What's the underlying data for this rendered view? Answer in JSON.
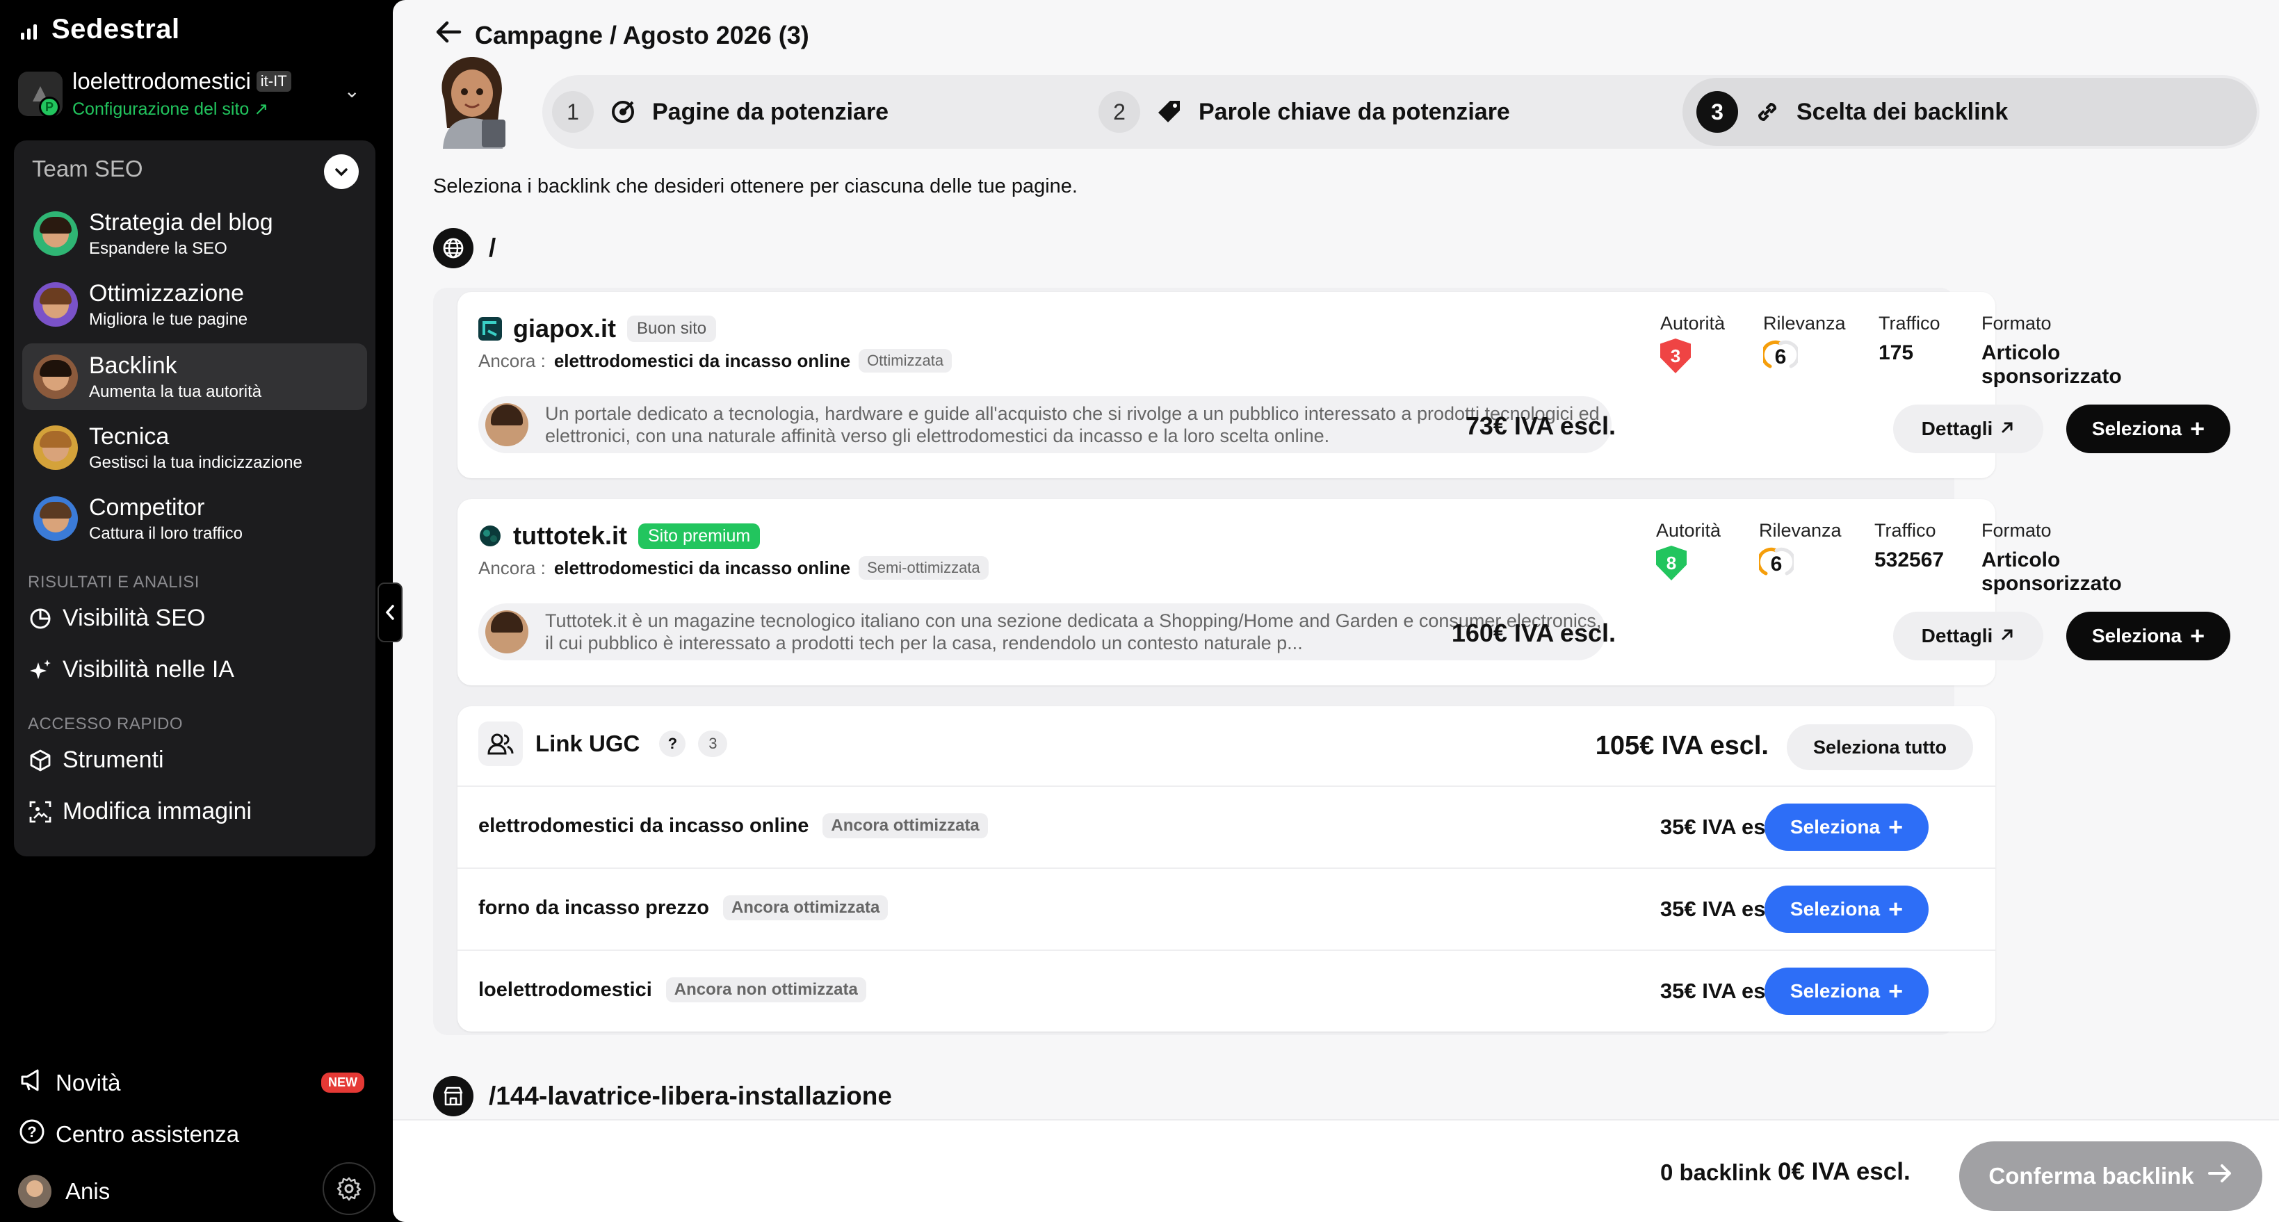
{
  "brand": {
    "name": "Sedestral"
  },
  "site": {
    "name": "loelettrodomestici",
    "locale": "it-IT",
    "config_link": "Configurazione del sito ↗",
    "logo_badge": "P"
  },
  "team": {
    "title": "Team SEO",
    "agents": [
      {
        "title": "Strategia del blog",
        "subtitle": "Espandere la SEO"
      },
      {
        "title": "Ottimizzazione",
        "subtitle": "Migliora le tue pagine"
      },
      {
        "title": "Backlink",
        "subtitle": "Aumenta la tua autorità"
      },
      {
        "title": "Tecnica",
        "subtitle": "Gestisci la tua indicizzazione"
      },
      {
        "title": "Competitor",
        "subtitle": "Cattura il loro traffico"
      }
    ],
    "section_results": "RISULTATI E ANALISI",
    "results_links": [
      "Visibilità SEO",
      "Visibilità nelle IA"
    ],
    "section_quick": "ACCESSO RAPIDO",
    "quick_links": [
      "Strumenti",
      "Modifica immagini"
    ]
  },
  "bottom": {
    "news": "Novità",
    "news_badge": "NEW",
    "help": "Centro assistenza",
    "user": "Anis"
  },
  "header": {
    "breadcrumb": "Campagne / Agosto 2026 (3)"
  },
  "steps": [
    {
      "num": "1",
      "label": "Pagine da potenziare"
    },
    {
      "num": "2",
      "label": "Parole chiave da potenziare"
    },
    {
      "num": "3",
      "label": "Scelta dei backlink"
    }
  ],
  "intro": "Seleziona i backlink che desideri ottenere per ciascuna delle tue pagine.",
  "pages": [
    {
      "path": "/"
    },
    {
      "path": "/144-lavatrice-libera-installazione"
    }
  ],
  "metric_labels": {
    "authority": "Autorità",
    "relevance": "Rilevanza",
    "traffic": "Traffico",
    "format": "Formato"
  },
  "anchor_label": "Ancora :",
  "offers": [
    {
      "domain": "giapox.it",
      "tag": "Buon sito",
      "anchor": "elettrodomestici da incasso online",
      "anchor_tag": "Ottimizzata",
      "authority": "3",
      "relevance": "6",
      "traffic": "175",
      "format": "Articolo sponsorizzato",
      "description": "Un portale dedicato a tecnologia, hardware e guide all'acquisto che si rivolge a un pubblico interessato a prodotti tecnologici ed elettronici, con una naturale affinità verso gli elettrodomestici da incasso e la loro scelta online.",
      "price": "73€ IVA escl.",
      "details_label": "Dettagli",
      "select_label": "Seleziona"
    },
    {
      "domain": "tuttotek.it",
      "tag": "Sito premium",
      "anchor": "elettrodomestici da incasso online",
      "anchor_tag": "Semi-ottimizzata",
      "authority": "8",
      "relevance": "6",
      "traffic": "532567",
      "format": "Articolo sponsorizzato",
      "description": "Tuttotek.it è un magazine tecnologico italiano con una sezione dedicata a Shopping/Home and Garden e consumer electronics, il cui pubblico è interessato a prodotti tech per la casa, rendendolo un contesto naturale p...",
      "price": "160€ IVA escl.",
      "details_label": "Dettagli",
      "select_label": "Seleziona"
    }
  ],
  "ugc": {
    "title": "Link UGC",
    "help": "?",
    "count": "3",
    "total": "105€ IVA escl.",
    "select_all": "Seleziona tutto",
    "rows": [
      {
        "anchor": "elettrodomestici da incasso online",
        "tag": "Ancora ottimizzata",
        "price": "35€ IVA escl.",
        "button": "Seleziona"
      },
      {
        "anchor": "forno da incasso prezzo",
        "tag": "Ancora ottimizzata",
        "price": "35€ IVA escl.",
        "button": "Seleziona"
      },
      {
        "anchor": "loelettrodomestici",
        "tag": "Ancora non ottimizzata",
        "price": "35€ IVA escl.",
        "button": "Seleziona"
      }
    ]
  },
  "footer": {
    "count": "0 backlink",
    "total": "0€ IVA escl.",
    "confirm": "Conferma backlink"
  },
  "colors": {
    "accent_blue": "#2d6ef7",
    "premium_green": "#22c55e",
    "authority_low": "#ef4444",
    "authority_high": "#22c55e",
    "relevance_orange": "#f59e0b"
  }
}
